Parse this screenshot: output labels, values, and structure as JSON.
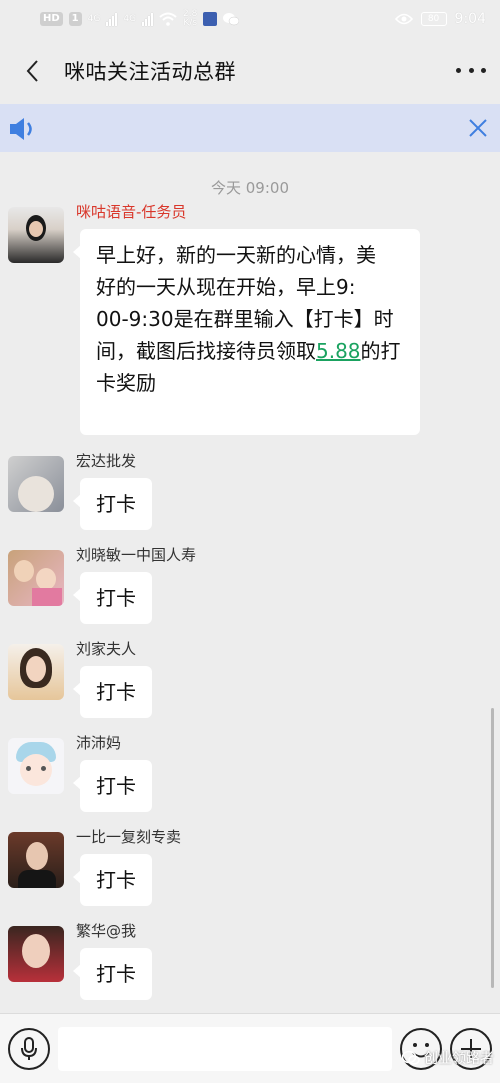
{
  "status_bar": {
    "hd_badge": "HD",
    "sim_badge": "1",
    "net_4g_1": "4G",
    "net_4g_2": "4G",
    "speed_value": "2.8",
    "speed_unit": "K/s",
    "time": "9:04",
    "battery": "80"
  },
  "header": {
    "title": "咪咕关注活动总群"
  },
  "chat": {
    "time_divider": "今天 09:00",
    "messages": [
      {
        "sender": "咪咕语音-任务员",
        "text_lines": [
          "早上好，新的一天新的心情，美",
          "好的一天从现在开始，早上9:",
          "00-9:30是在群里输入【打卡】时",
          "间，截图后找接待员领取"
        ],
        "link_text": "5.88",
        "text_tail_1": "的打",
        "text_tail_2": "卡奖励"
      },
      {
        "sender": "宏达批发",
        "text": "打卡"
      },
      {
        "sender": "刘晓敏一中国人寿",
        "text": "打卡"
      },
      {
        "sender": "刘家夫人",
        "text": "打卡"
      },
      {
        "sender": "沛沛妈",
        "text": "打卡"
      },
      {
        "sender": "一比一复刻专卖",
        "text": "打卡"
      },
      {
        "sender": "繁华@我",
        "text": "打卡"
      }
    ]
  },
  "input_bar": {
    "placeholder": ""
  },
  "watermark": "创业领路者",
  "colors": {
    "background": "#ededed",
    "notice_bar": "#d9e0f4",
    "accent_blue": "#3f7fe0",
    "sender_red": "#d9372b",
    "link_green": "#1aa260"
  },
  "icons": [
    "back-arrow-icon",
    "more-dots-icon",
    "speaker-icon",
    "close-icon",
    "voice-icon",
    "emoji-icon",
    "plus-icon"
  ]
}
